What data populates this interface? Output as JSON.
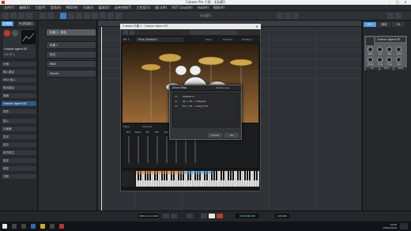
{
  "window": {
    "title": "Cubase Pro 工程 - 无标题1"
  },
  "menu": [
    "文件(F)",
    "编辑(E)",
    "工程(P)",
    "音频(A)",
    "MIDI(M)",
    "乐谱(S)",
    "媒体(D)",
    "走带控制(T)",
    "工作室(S)",
    "窗口(W)",
    "VST Cloud(H)",
    "Hub(H)",
    "帮助(H)"
  ],
  "project_title": "无标题1",
  "inspector": {
    "tabs": [
      "检视器",
      "可见性窗口"
    ],
    "track_name": "Groove Agent SE",
    "rows": [
      "乐器",
      "输入路由",
      "MIDI 输入",
      "输出路由",
      "通道",
      "Groove Agent SE",
      "音色",
      "插入",
      "均衡器",
      "发送",
      "弦乐",
      "音符表达",
      "量化",
      "和弦",
      "注释"
    ],
    "channel_label": "GA SE 1"
  },
  "tracks": [
    {
      "label": "乐器 1 - 音色"
    },
    {
      "label": "轨道 1"
    },
    {
      "label": "标记"
    },
    {
      "label": "MIDI"
    },
    {
      "label": "Vocals"
    }
  ],
  "plugin": {
    "title": "Cubase 乐器 1 - Groove Agent SE",
    "preset": "Pure (default)",
    "tabs": [
      "Mixer",
      "Pad Edit",
      "Kit Mixer"
    ],
    "section_labels": [
      "Kit 1",
      "Mixer",
      "Channel"
    ],
    "channel_labels": [
      "Kick",
      "Snare",
      "HH",
      "Tom",
      "Cym",
      "Amb",
      "Room",
      "Master"
    ]
  },
  "mapping_dialog": {
    "title": "Drum Map",
    "header_right": "Preferences",
    "rows": [
      {
        "num": "00",
        "text": "default.ini"
      },
      {
        "num": "01",
        "text": "01 + C0 ~ Analyser"
      },
      {
        "num": "02",
        "text": "02 + C0 ~ snap_fx M"
      }
    ],
    "cancel": "Cancel",
    "ok": "OK"
  },
  "right_panel": {
    "tabs": [
      "VSTi",
      "媒体",
      "CR"
    ],
    "instrument": "Groove Agent SE",
    "knob_labels": [
      "Pitch",
      "Vol",
      "Pan",
      "Send",
      "Decay",
      "Tone",
      "Tune",
      "Cut"
    ],
    "buttons": [
      "Kit",
      "Pads",
      "Mixer"
    ]
  },
  "bottom_tabs": [
    "轨道",
    "编辑器"
  ],
  "transport": {
    "tempo": "120.000",
    "position": "0001.01.01.000",
    "time": "00:00:00.000"
  },
  "taskbar": {
    "time": "19:45",
    "date": "2019/10/24"
  },
  "colors": {
    "accent": "#3c7fc1",
    "active_tab": "#4d9ee6",
    "plugin_bg": "#141516"
  }
}
